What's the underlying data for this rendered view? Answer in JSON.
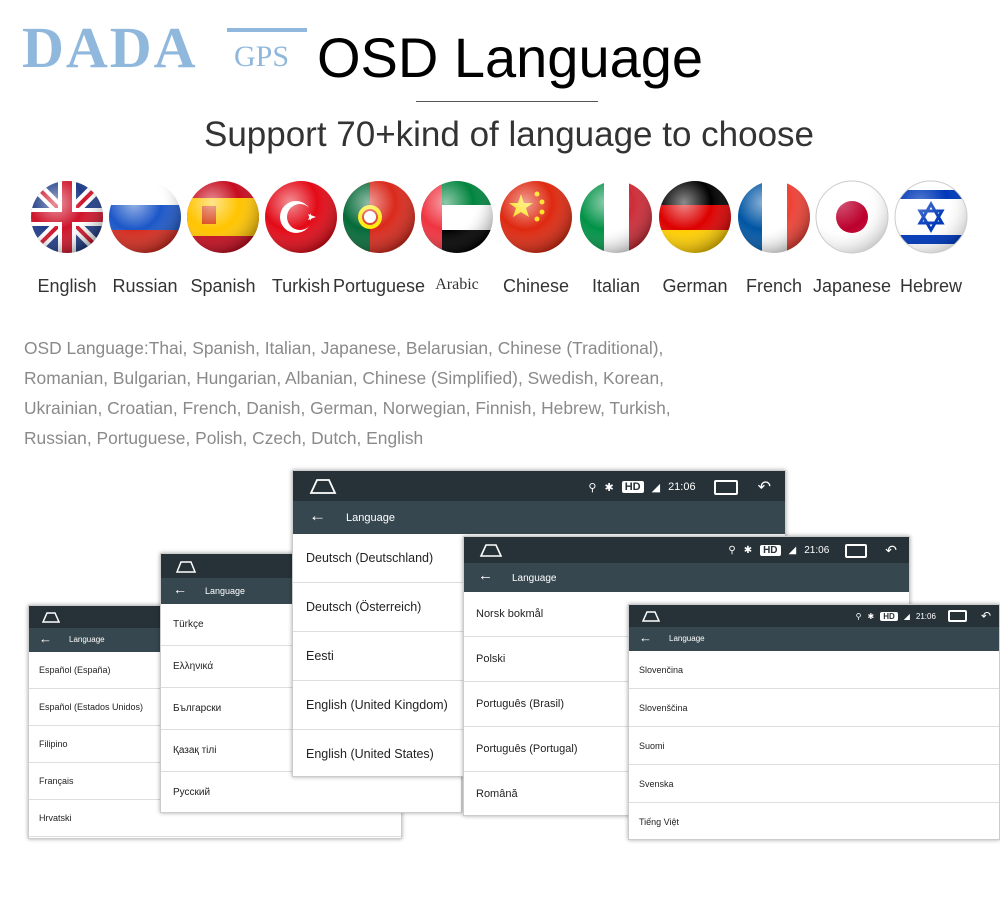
{
  "logo": {
    "main": "DADA",
    "sub": "GPS"
  },
  "title": "OSD Language",
  "subtitle": "Support 70+kind of language to choose",
  "flags": [
    {
      "label": "English",
      "icon": "uk-flag-icon"
    },
    {
      "label": "Russian",
      "icon": "russia-flag-icon"
    },
    {
      "label": "Spanish",
      "icon": "spain-flag-icon"
    },
    {
      "label": "Turkish",
      "icon": "turkey-flag-icon"
    },
    {
      "label": "Portuguese",
      "icon": "portugal-flag-icon"
    },
    {
      "label": "Arabic",
      "icon": "uae-flag-icon"
    },
    {
      "label": "Chinese",
      "icon": "china-flag-icon"
    },
    {
      "label": "Italian",
      "icon": "italy-flag-icon"
    },
    {
      "label": "German",
      "icon": "germany-flag-icon"
    },
    {
      "label": "French",
      "icon": "france-flag-icon"
    },
    {
      "label": "Japanese",
      "icon": "japan-flag-icon"
    },
    {
      "label": "Hebrew",
      "icon": "israel-flag-icon"
    }
  ],
  "osd_text": {
    "line1": "OSD Language:Thai, Spanish, Italian, Japanese, Belarusian, Chinese (Traditional),",
    "line2": "Romanian, Bulgarian, Hungarian, Albanian, Chinese (Simplified), Swedish, Korean,",
    "line3": "Ukrainian, Croatian, French, Danish, German, Norwegian, Finnish, Hebrew, Turkish,",
    "line4": "Russian, Portuguese, Polish, Czech, Dutch, English"
  },
  "status": {
    "hd": "HD",
    "time": "21:06"
  },
  "screens": [
    {
      "header": "Language",
      "items": [
        "Español (España)",
        "Español (Estados Unidos)",
        "Filipino",
        "Français",
        "Hrvatski"
      ]
    },
    {
      "header": "Language",
      "items": [
        "Türkçe",
        "Ελληνικά",
        "Български",
        "Қазақ тілі",
        "Русский"
      ]
    },
    {
      "header": "Language",
      "items": [
        "Deutsch (Deutschland)",
        "Deutsch (Österreich)",
        "Eesti",
        "English (United Kingdom)",
        "English (United States)"
      ]
    },
    {
      "header": "Language",
      "items": [
        "Norsk bokmål",
        "Polski",
        "Português (Brasil)",
        "Português (Portugal)",
        "Română"
      ]
    },
    {
      "header": "Language",
      "items": [
        "Slovenčina",
        "Slovenščina",
        "Suomi",
        "Svenska",
        "Tiếng Việt"
      ]
    }
  ]
}
